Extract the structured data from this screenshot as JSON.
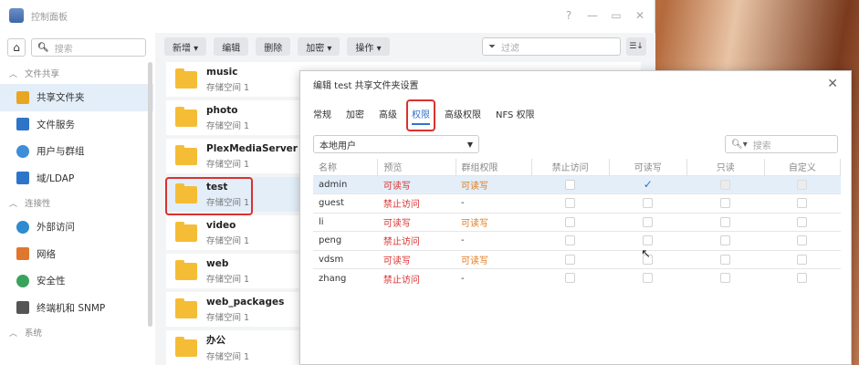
{
  "window": {
    "title": "控制面板"
  },
  "sidebar": {
    "search_placeholder": "搜索",
    "sections": {
      "file_sharing": "文件共享",
      "connectivity": "连接性",
      "system": "系统"
    },
    "items": [
      {
        "label": "共享文件夹",
        "icon": "shared-folder-icon",
        "color": "#e9a623"
      },
      {
        "label": "文件服务",
        "icon": "file-services-icon",
        "color": "#2e74c9"
      },
      {
        "label": "用户与群组",
        "icon": "user-group-icon",
        "color": "#3c8fd8"
      },
      {
        "label": "域/LDAP",
        "icon": "domain-icon",
        "color": "#2e74c9"
      },
      {
        "label": "外部访问",
        "icon": "external-access-icon",
        "color": "#2e8bd0"
      },
      {
        "label": "网络",
        "icon": "network-icon",
        "color": "#e0772f"
      },
      {
        "label": "安全性",
        "icon": "security-icon",
        "color": "#3aa35b"
      },
      {
        "label": "终端机和 SNMP",
        "icon": "terminal-icon",
        "color": "#555555"
      }
    ]
  },
  "toolbar": {
    "create": "新增 ▾",
    "edit": "编辑",
    "delete": "删除",
    "encrypt": "加密 ▾",
    "action": "操作 ▾",
    "filter_placeholder": "过滤"
  },
  "folders": [
    {
      "name": "music",
      "sub": "存储空间 1"
    },
    {
      "name": "photo",
      "sub": "存储空间 1"
    },
    {
      "name": "PlexMediaServer",
      "sub": "存储空间 1"
    },
    {
      "name": "test",
      "sub": "存储空间 1"
    },
    {
      "name": "video",
      "sub": "存储空间 1"
    },
    {
      "name": "web",
      "sub": "存储空间 1"
    },
    {
      "name": "web_packages",
      "sub": "存储空间 1"
    },
    {
      "name": "办公",
      "sub": "存储空间 1"
    }
  ],
  "dialog": {
    "title": "编辑 test 共享文件夹设置",
    "tabs": [
      "常规",
      "加密",
      "高级",
      "权限",
      "高级权限",
      "NFS 权限"
    ],
    "active_tab": "权限",
    "user_type": "本地用户",
    "search_placeholder": "搜索",
    "columns": [
      "名称",
      "预览",
      "群组权限",
      "禁止访问",
      "可读写",
      "只读",
      "自定义"
    ],
    "rows": [
      {
        "name": "admin",
        "preview": "可读写",
        "group": "可读写",
        "deny": false,
        "rw": true,
        "ro": false,
        "custom": false
      },
      {
        "name": "guest",
        "preview": "禁止访问",
        "group": "-",
        "deny": false,
        "rw": false,
        "ro": false,
        "custom": false
      },
      {
        "name": "li",
        "preview": "可读写",
        "group": "可读写",
        "deny": false,
        "rw": false,
        "ro": false,
        "custom": false
      },
      {
        "name": "peng",
        "preview": "禁止访问",
        "group": "-",
        "deny": false,
        "rw": false,
        "ro": false,
        "custom": false
      },
      {
        "name": "vdsm",
        "preview": "可读写",
        "group": "可读写",
        "deny": false,
        "rw": false,
        "ro": false,
        "custom": false
      },
      {
        "name": "zhang",
        "preview": "禁止访问",
        "group": "-",
        "deny": false,
        "rw": false,
        "ro": false,
        "custom": false
      }
    ]
  },
  "colors": {
    "accent": "#2e74c9",
    "highlight": "#d9322f",
    "deny_text": "#d9322f",
    "rw_text": "#e07a1f",
    "folder": "#f5bd35"
  }
}
